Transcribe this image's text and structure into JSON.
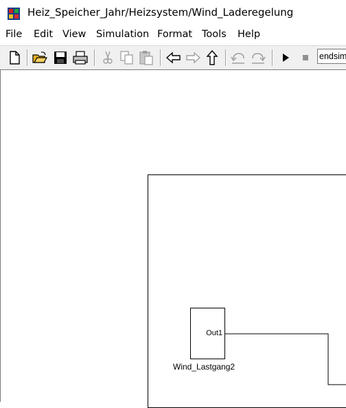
{
  "window": {
    "title": "Heiz_Speicher_Jahr/Heizsystem/Wind_Laderegelung"
  },
  "menu": {
    "items": [
      "File",
      "Edit",
      "View",
      "Simulation",
      "Format",
      "Tools",
      "Help"
    ]
  },
  "toolbar": {
    "buttons": [
      "new-icon",
      "open-icon",
      "save-icon",
      "print-icon",
      "cut-icon",
      "copy-icon",
      "paste-icon",
      "back-icon",
      "forward-icon",
      "up-icon",
      "undo-icon",
      "redo-icon",
      "play-icon",
      "stop-icon"
    ],
    "stop_time_value": "endsim"
  },
  "diagram": {
    "block": {
      "port_label": "Out1",
      "name": "Wind_Lastgang2"
    }
  },
  "colors": {
    "toolbar_bg": "#f0f0f0",
    "folder_yellow": "#e8b020",
    "icon_disabled": "#a0a0a0"
  }
}
